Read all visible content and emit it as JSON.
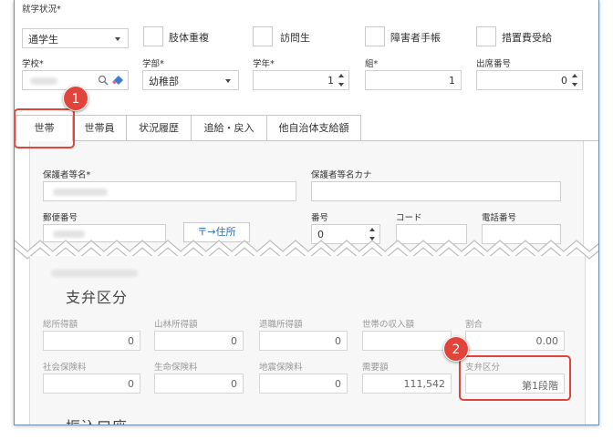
{
  "top": {
    "enroll_status_label": "就学状況*",
    "enroll_status_value": "通学生",
    "checkboxes": [
      {
        "label": "肢体重複"
      },
      {
        "label": "訪問生"
      },
      {
        "label": "障害者手帳"
      },
      {
        "label": "措置費受給"
      }
    ],
    "school_label": "学校*",
    "department_label": "学部*",
    "department_value": "幼稚部",
    "grade_label": "学年*",
    "grade_value": "1",
    "class_label": "組*",
    "class_value": "1",
    "attendance_label": "出席番号",
    "attendance_value": "0"
  },
  "tabs": [
    {
      "label": "世帯"
    },
    {
      "label": "世帯員"
    },
    {
      "label": "状況履歴"
    },
    {
      "label": "追給・戻入"
    },
    {
      "label": "他自治体支給額"
    }
  ],
  "household": {
    "guardian_name_label": "保護者等名*",
    "guardian_kana_label": "保護者等名カナ",
    "postal_label": "郵便番号",
    "postal_button": "〒→住所",
    "number_label": "番号",
    "number_value": "0",
    "code_label": "コード",
    "phone_label": "電話番号"
  },
  "payment": {
    "title": "支弁区分",
    "fields_row1": [
      {
        "label": "総所得額",
        "value": "0"
      },
      {
        "label": "山林所得額",
        "value": "0"
      },
      {
        "label": "退職所得額",
        "value": "0"
      },
      {
        "label": "世帯の収入額",
        "value": ""
      },
      {
        "label": "割合",
        "value": "0.00"
      }
    ],
    "fields_row2": [
      {
        "label": "社会保険料",
        "value": "0"
      },
      {
        "label": "生命保険料",
        "value": "0"
      },
      {
        "label": "地震保険料",
        "value": "0"
      },
      {
        "label": "需要額",
        "value": "111,542"
      },
      {
        "label": "支弁区分",
        "value": "第1段階"
      }
    ]
  },
  "bank": {
    "title": "振込口座"
  },
  "callouts": [
    "1",
    "2"
  ],
  "colors": {
    "accent_red": "#e0443a",
    "link_blue": "#2a6bb5",
    "frame_border": "#6f8db3"
  },
  "icons": [
    "search-icon",
    "eraser-icon",
    "chevron-down-icon",
    "spinner-icon"
  ]
}
